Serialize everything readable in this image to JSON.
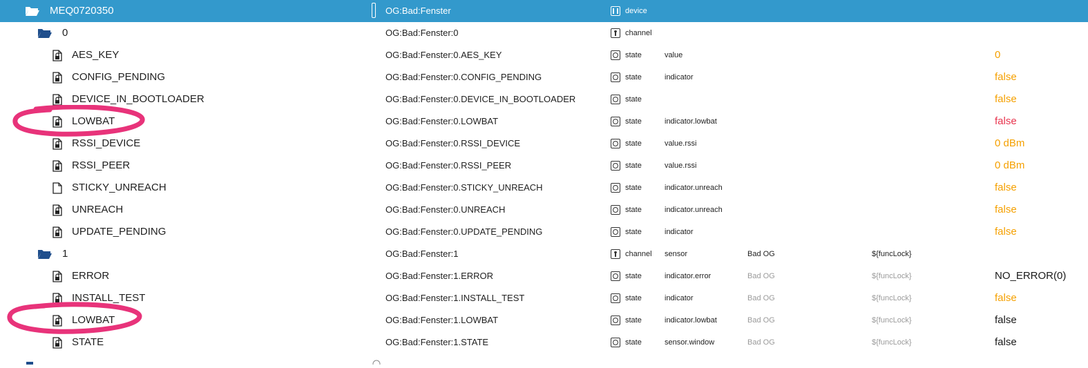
{
  "rows": [
    {
      "level": 0,
      "icon": "folder-open-icon",
      "name": "MEQ0720350",
      "id": "OG:Bad:Fenster",
      "type": "device",
      "role": "",
      "room": "",
      "func": "",
      "value": "",
      "valueColor": "",
      "selected": true
    },
    {
      "level": 1,
      "icon": "folder-open-icon",
      "name": "0",
      "id": "OG:Bad:Fenster:0",
      "type": "channel",
      "role": "",
      "room": "",
      "func": "",
      "value": "",
      "valueColor": ""
    },
    {
      "level": 2,
      "icon": "file-lock-icon",
      "name": "AES_KEY",
      "id": "OG:Bad:Fenster:0.AES_KEY",
      "type": "state",
      "role": "value",
      "room": "",
      "func": "",
      "value": "0",
      "valueColor": "orange"
    },
    {
      "level": 2,
      "icon": "file-lock-icon",
      "name": "CONFIG_PENDING",
      "id": "OG:Bad:Fenster:0.CONFIG_PENDING",
      "type": "state",
      "role": "indicator",
      "room": "",
      "func": "",
      "value": "false",
      "valueColor": "orange"
    },
    {
      "level": 2,
      "icon": "file-lock-icon",
      "name": "DEVICE_IN_BOOTLOADER",
      "id": "OG:Bad:Fenster:0.DEVICE_IN_BOOTLOADER",
      "type": "state",
      "role": "",
      "room": "",
      "func": "",
      "value": "false",
      "valueColor": "orange"
    },
    {
      "level": 2,
      "icon": "file-lock-icon",
      "name": "LOWBAT",
      "id": "OG:Bad:Fenster:0.LOWBAT",
      "type": "state",
      "role": "indicator.lowbat",
      "room": "",
      "func": "",
      "value": "false",
      "valueColor": "red",
      "circled": true
    },
    {
      "level": 2,
      "icon": "file-lock-icon",
      "name": "RSSI_DEVICE",
      "id": "OG:Bad:Fenster:0.RSSI_DEVICE",
      "type": "state",
      "role": "value.rssi",
      "room": "",
      "func": "",
      "value": "0 dBm",
      "valueColor": "orange"
    },
    {
      "level": 2,
      "icon": "file-lock-icon",
      "name": "RSSI_PEER",
      "id": "OG:Bad:Fenster:0.RSSI_PEER",
      "type": "state",
      "role": "value.rssi",
      "room": "",
      "func": "",
      "value": "0 dBm",
      "valueColor": "orange"
    },
    {
      "level": 2,
      "icon": "file-icon",
      "name": "STICKY_UNREACH",
      "id": "OG:Bad:Fenster:0.STICKY_UNREACH",
      "type": "state",
      "role": "indicator.unreach",
      "room": "",
      "func": "",
      "value": "false",
      "valueColor": "orange"
    },
    {
      "level": 2,
      "icon": "file-lock-icon",
      "name": "UNREACH",
      "id": "OG:Bad:Fenster:0.UNREACH",
      "type": "state",
      "role": "indicator.unreach",
      "room": "",
      "func": "",
      "value": "false",
      "valueColor": "orange"
    },
    {
      "level": 2,
      "icon": "file-lock-icon",
      "name": "UPDATE_PENDING",
      "id": "OG:Bad:Fenster:0.UPDATE_PENDING",
      "type": "state",
      "role": "indicator",
      "room": "",
      "func": "",
      "value": "false",
      "valueColor": "orange"
    },
    {
      "level": 1,
      "icon": "folder-open-icon",
      "name": "1",
      "id": "OG:Bad:Fenster:1",
      "type": "channel",
      "role": "sensor",
      "room": "Bad OG",
      "func": "${funcLock}",
      "value": "",
      "valueColor": "",
      "roomMuted": false
    },
    {
      "level": 2,
      "icon": "file-lock-icon",
      "name": "ERROR",
      "id": "OG:Bad:Fenster:1.ERROR",
      "type": "state",
      "role": "indicator.error",
      "room": "Bad OG",
      "func": "${funcLock}",
      "value": "NO_ERROR(0)",
      "valueColor": "black",
      "roomMuted": true
    },
    {
      "level": 2,
      "icon": "file-lock-icon",
      "name": "INSTALL_TEST",
      "id": "OG:Bad:Fenster:1.INSTALL_TEST",
      "type": "state",
      "role": "indicator",
      "room": "Bad OG",
      "func": "${funcLock}",
      "value": "false",
      "valueColor": "orange",
      "roomMuted": true
    },
    {
      "level": 2,
      "icon": "file-lock-icon",
      "name": "LOWBAT",
      "id": "OG:Bad:Fenster:1.LOWBAT",
      "type": "state",
      "role": "indicator.lowbat",
      "room": "Bad OG",
      "func": "${funcLock}",
      "value": "false",
      "valueColor": "black",
      "roomMuted": true,
      "circled": true
    },
    {
      "level": 2,
      "icon": "file-lock-icon",
      "name": "STATE",
      "id": "OG:Bad:Fenster:1.STATE",
      "type": "state",
      "role": "sensor.window",
      "room": "Bad OG",
      "func": "${funcLock}",
      "value": "false",
      "valueColor": "black",
      "roomMuted": true
    }
  ],
  "colors": {
    "selected": "#3399cc",
    "folder": "#1f4e8c",
    "orange": "#f5a000",
    "red": "#e8344e",
    "black": "#1a1a1a",
    "annotation": "#e8337a"
  }
}
